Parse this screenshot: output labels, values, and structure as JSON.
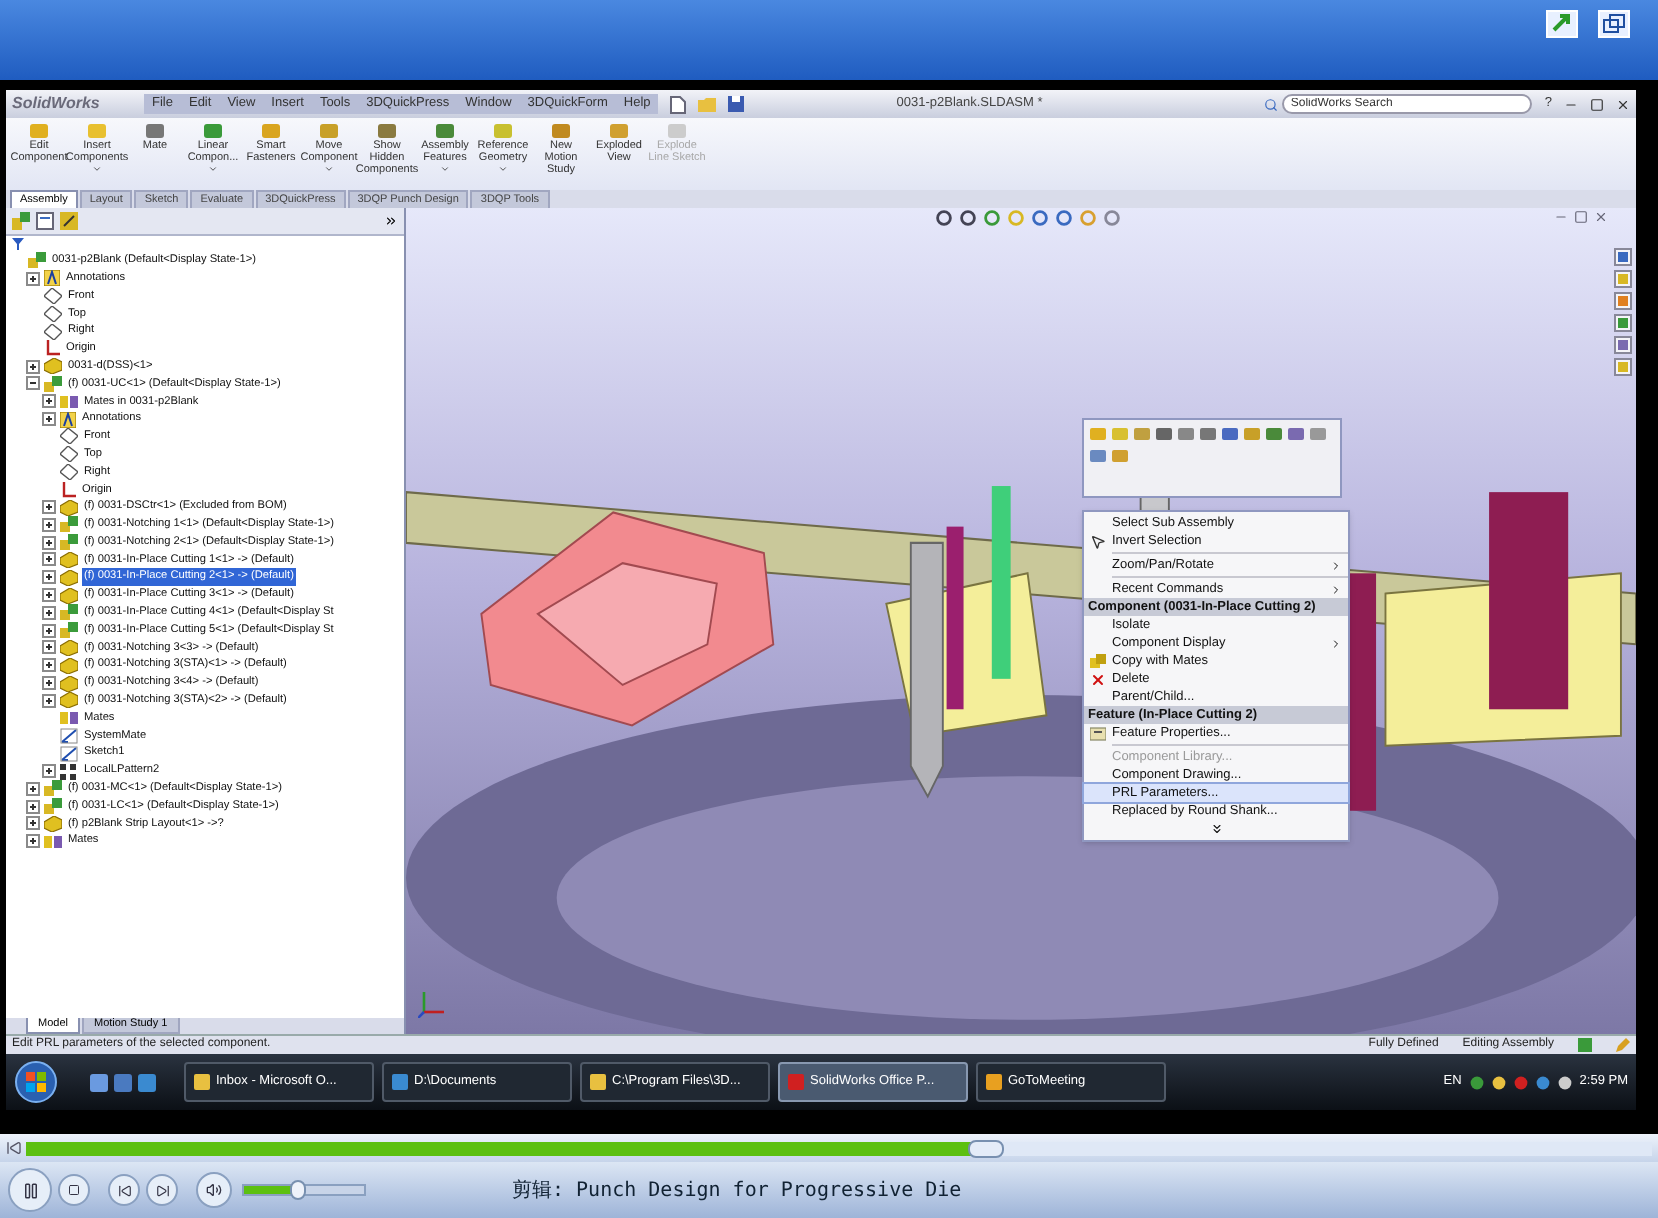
{
  "player": {
    "clip_label": "剪辑: Punch Design for Progressive Die",
    "seek": {
      "level": 0.59
    },
    "volume": {
      "level": 0.45
    }
  },
  "solidworks": {
    "logo": "SolidWorks",
    "menus": [
      "File",
      "Edit",
      "View",
      "Insert",
      "Tools",
      "3DQuickPress",
      "Window",
      "3DQuickForm",
      "Help"
    ],
    "document_title": "0031-p2Blank.SLDASM *",
    "search": {
      "placeholder": "SolidWorks Search"
    },
    "help": "?",
    "commands": [
      {
        "label": "Edit Component",
        "has_menu": false,
        "disabled": false
      },
      {
        "label": "Insert Components",
        "has_menu": true,
        "disabled": false
      },
      {
        "label": "Mate",
        "has_menu": false,
        "disabled": false
      },
      {
        "label": "Linear Compon...",
        "has_menu": true,
        "disabled": false
      },
      {
        "label": "Smart Fasteners",
        "has_menu": false,
        "disabled": false
      },
      {
        "label": "Move Component",
        "has_menu": true,
        "disabled": false
      },
      {
        "label": "Show Hidden Components",
        "has_menu": false,
        "disabled": false
      },
      {
        "label": "Assembly Features",
        "has_menu": true,
        "disabled": false
      },
      {
        "label": "Reference Geometry",
        "has_menu": true,
        "disabled": false
      },
      {
        "label": "New Motion Study",
        "has_menu": false,
        "disabled": false
      },
      {
        "label": "Exploded View",
        "has_menu": false,
        "disabled": false
      },
      {
        "label": "Explode Line Sketch",
        "has_menu": false,
        "disabled": true
      }
    ],
    "tabs": [
      {
        "label": "Assembly",
        "selected": true
      },
      {
        "label": "Layout",
        "selected": false
      },
      {
        "label": "Sketch",
        "selected": false
      },
      {
        "label": "Evaluate",
        "selected": false
      },
      {
        "label": "3DQuickPress",
        "selected": false
      },
      {
        "label": "3DQP Punch Design",
        "selected": false
      },
      {
        "label": "3DQP Tools",
        "selected": false
      }
    ],
    "tree": [
      {
        "label": "0031-p2Blank  (Default<Display State-1>)",
        "kind": "assembly",
        "selected": false,
        "children": [
          {
            "label": "Annotations",
            "kind": "annotations",
            "selected": false,
            "expanded": false
          },
          {
            "label": "Front",
            "kind": "plane",
            "selected": false
          },
          {
            "label": "Top",
            "kind": "plane",
            "selected": false
          },
          {
            "label": "Right",
            "kind": "plane",
            "selected": false
          },
          {
            "label": "Origin",
            "kind": "origin",
            "selected": false
          },
          {
            "label": "0031-d(DSS)<1>",
            "kind": "part",
            "selected": false,
            "expanded": false
          },
          {
            "label": "(f) 0031-UC<1>  (Default<Display State-1>)",
            "kind": "assembly",
            "selected": false,
            "expanded": true,
            "children": [
              {
                "label": "Mates in 0031-p2Blank",
                "kind": "mates",
                "selected": false,
                "expanded": false
              },
              {
                "label": "Annotations",
                "kind": "annotations",
                "selected": false,
                "expanded": false
              },
              {
                "label": "Front",
                "kind": "plane",
                "selected": false
              },
              {
                "label": "Top",
                "kind": "plane",
                "selected": false
              },
              {
                "label": "Right",
                "kind": "plane",
                "selected": false
              },
              {
                "label": "Origin",
                "kind": "origin",
                "selected": false
              },
              {
                "label": "(f) 0031-DSCtr<1> (Excluded from BOM)",
                "kind": "part",
                "selected": false,
                "expanded": false
              },
              {
                "label": "(f) 0031-Notching 1<1> (Default<Display State-1>)",
                "kind": "assembly",
                "selected": false,
                "expanded": false
              },
              {
                "label": "(f) 0031-Notching 2<1> (Default<Display State-1>)",
                "kind": "assembly",
                "selected": false,
                "expanded": false
              },
              {
                "label": "(f) 0031-In-Place Cutting 1<1> -> (Default)",
                "kind": "part",
                "selected": false,
                "expanded": false
              },
              {
                "label": "(f) 0031-In-Place Cutting 2<1> -> (Default)",
                "kind": "part",
                "selected": true,
                "expanded": false
              },
              {
                "label": "(f) 0031-In-Place Cutting 3<1> -> (Default)",
                "kind": "part",
                "selected": false,
                "expanded": false
              },
              {
                "label": "(f) 0031-In-Place Cutting 4<1> (Default<Display St",
                "kind": "assembly",
                "selected": false,
                "expanded": false
              },
              {
                "label": "(f) 0031-In-Place Cutting 5<1> (Default<Display St",
                "kind": "assembly",
                "selected": false,
                "expanded": false
              },
              {
                "label": "(f) 0031-Notching 3<3> -> (Default)",
                "kind": "part",
                "selected": false,
                "expanded": false
              },
              {
                "label": "(f) 0031-Notching 3(STA)<1> -> (Default)",
                "kind": "part",
                "selected": false,
                "expanded": false
              },
              {
                "label": "(f) 0031-Notching 3<4> -> (Default)",
                "kind": "part",
                "selected": false,
                "expanded": false
              },
              {
                "label": "(f) 0031-Notching 3(STA)<2> -> (Default)",
                "kind": "part",
                "selected": false,
                "expanded": false
              },
              {
                "label": "Mates",
                "kind": "mates",
                "selected": false
              },
              {
                "label": "SystemMate",
                "kind": "sketch",
                "selected": false
              },
              {
                "label": "Sketch1",
                "kind": "sketch",
                "selected": false
              },
              {
                "label": "LocalLPattern2",
                "kind": "pattern",
                "selected": false,
                "expanded": false
              }
            ]
          },
          {
            "label": "(f) 0031-MC<1>  (Default<Display State-1>)",
            "kind": "assembly",
            "selected": false,
            "expanded": false
          },
          {
            "label": "(f) 0031-LC<1>  (Default<Display State-1>)",
            "kind": "assembly",
            "selected": false,
            "expanded": false
          },
          {
            "label": "(f) p2Blank Strip Layout<1> ->?",
            "kind": "part",
            "selected": false,
            "expanded": false
          },
          {
            "label": "Mates",
            "kind": "mates",
            "selected": false,
            "expanded": false
          }
        ]
      }
    ],
    "bottom_tabs": [
      {
        "label": "Model",
        "selected": true
      },
      {
        "label": "Motion Study 1",
        "selected": false
      }
    ],
    "context_menu": [
      {
        "kind": "item",
        "label": "Select Sub Assembly",
        "submenu": false,
        "disabled": false,
        "selected": false
      },
      {
        "kind": "item",
        "label": "Invert Selection",
        "submenu": false,
        "disabled": false,
        "selected": false
      },
      {
        "kind": "separator"
      },
      {
        "kind": "item",
        "label": "Zoom/Pan/Rotate",
        "submenu": true,
        "disabled": false,
        "selected": false
      },
      {
        "kind": "separator"
      },
      {
        "kind": "item",
        "label": "Recent Commands",
        "submenu": true,
        "disabled": false,
        "selected": false
      },
      {
        "kind": "header",
        "label": "Component (0031-In-Place Cutting 2)"
      },
      {
        "kind": "item",
        "label": "Isolate",
        "submenu": false,
        "disabled": false,
        "selected": false
      },
      {
        "kind": "item",
        "label": "Component Display",
        "submenu": true,
        "disabled": false,
        "selected": false
      },
      {
        "kind": "item",
        "label": "Copy with Mates",
        "submenu": false,
        "disabled": false,
        "selected": false
      },
      {
        "kind": "item",
        "label": "Delete",
        "submenu": false,
        "disabled": false,
        "selected": false
      },
      {
        "kind": "item",
        "label": "Parent/Child...",
        "submenu": false,
        "disabled": false,
        "selected": false
      },
      {
        "kind": "header",
        "label": "Feature (In-Place Cutting 2)"
      },
      {
        "kind": "item",
        "label": "Feature Properties...",
        "submenu": false,
        "disabled": false,
        "selected": false
      },
      {
        "kind": "separator"
      },
      {
        "kind": "item",
        "label": "Component Library...",
        "submenu": false,
        "disabled": true,
        "selected": false
      },
      {
        "kind": "item",
        "label": "Component Drawing...",
        "submenu": false,
        "disabled": false,
        "selected": false
      },
      {
        "kind": "item",
        "label": "PRL Parameters...",
        "submenu": false,
        "disabled": false,
        "selected": true
      },
      {
        "kind": "item",
        "label": "Replaced by Round Shank...",
        "submenu": false,
        "disabled": false,
        "selected": false
      },
      {
        "kind": "more"
      }
    ],
    "status_bar": {
      "message": "Edit PRL parameters of the selected component.",
      "state": "Fully Defined",
      "mode": "Editing Assembly"
    }
  },
  "taskbar": {
    "tasks": [
      {
        "label": "Inbox - Microsoft O...",
        "selected": false
      },
      {
        "label": "D:\\Documents",
        "selected": false
      },
      {
        "label": "C:\\Program Files\\3D...",
        "selected": false
      },
      {
        "label": "SolidWorks Office P...",
        "selected": true
      },
      {
        "label": "GoToMeeting",
        "selected": false
      }
    ],
    "language": "EN",
    "clock": "2:59 PM"
  }
}
